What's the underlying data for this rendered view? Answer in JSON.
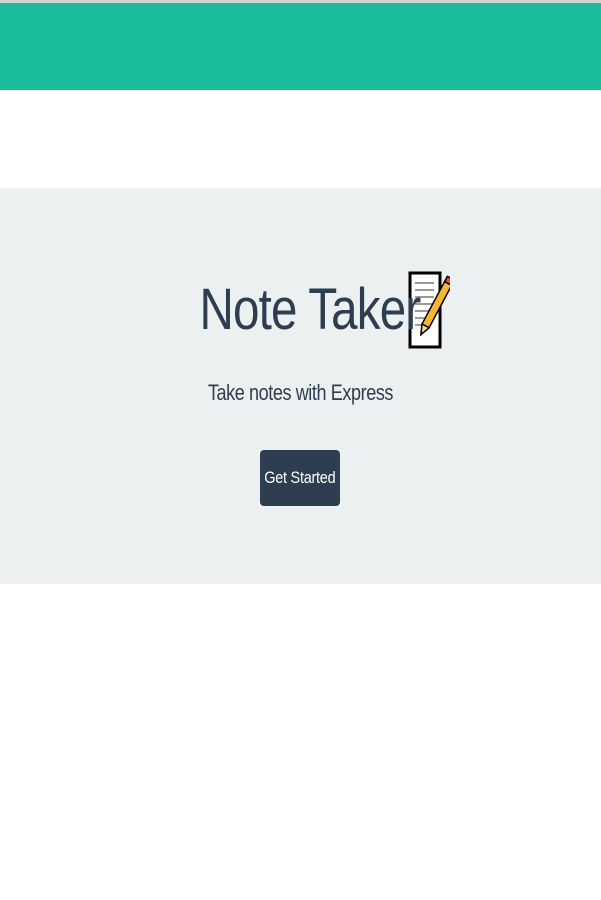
{
  "navbar": {
    "color": "#1abc9c"
  },
  "hero": {
    "title": "Note Taker",
    "title_icon": "memo-icon",
    "subtitle": "Take notes with Express",
    "cta_label": "Get Started",
    "background": "#ecf0f1",
    "text_color": "#2c3e50",
    "button_color": "#2c3e50"
  }
}
